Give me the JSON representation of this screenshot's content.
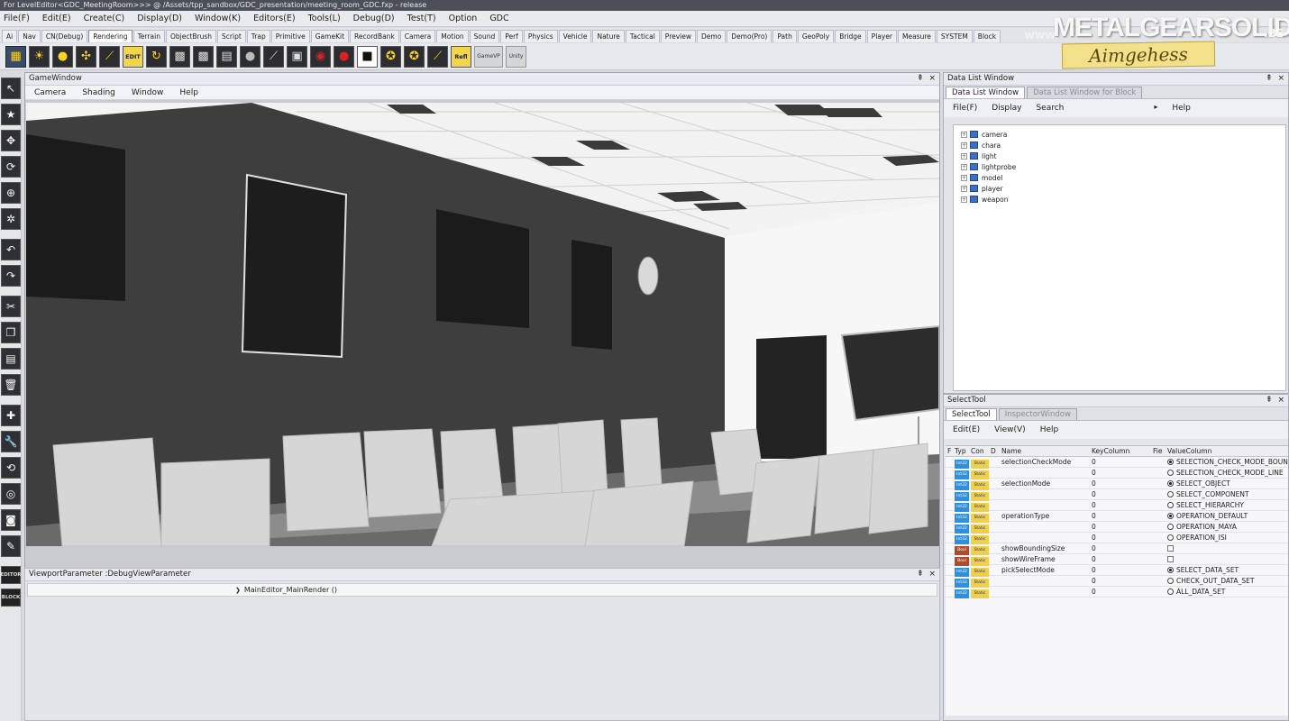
{
  "window": {
    "title": "For LevelEditor<GDC_MeetingRoom>>> @ /Assets/tpp_sandbox/GDC_presentation/meeting_room_GDC.fxp - release"
  },
  "menubar": [
    "File(F)",
    "Edit(E)",
    "Create(C)",
    "Display(D)",
    "Window(K)",
    "Editors(E)",
    "Tools(L)",
    "Debug(D)",
    "Test(T)",
    "Option",
    "GDC"
  ],
  "tabs": [
    "Ai",
    "Nav",
    "CN(Debug)",
    "Rendering",
    "Terrain",
    "ObjectBrush",
    "Script",
    "Trap",
    "Primitive",
    "GameKit",
    "RecordBank",
    "Camera",
    "Motion",
    "Sound",
    "Perf",
    "Physics",
    "Vehicle",
    "Nature",
    "Tactical",
    "Preview",
    "Demo",
    "Demo(Pro)",
    "Path",
    "GeoPoly",
    "Bridge",
    "Player",
    "Measure",
    "SYSTEM",
    "Block"
  ],
  "active_tab": "Rendering",
  "toolbar": {
    "buttons": [
      "image-icon",
      "sun-icon",
      "bulb-icon",
      "fan-icon",
      "feather-icon",
      "edit-icon",
      "cycle-icon",
      "checker-icon",
      "checker2-icon",
      "grid-icon",
      "sphere-icon",
      "brush-icon",
      "frame-icon",
      "record-icon",
      "record-dot-icon",
      "stop-icon",
      "owl-icon",
      "owl2-icon",
      "feather2-icon",
      "refl-icon"
    ],
    "edit_label": "EDIT",
    "refl_label": "Refl",
    "extra1": "GameVP",
    "extra2": "Unity"
  },
  "left_tools": {
    "editor_label": "EDITOR",
    "block_label": "BLOCK"
  },
  "game_window": {
    "title": "GameWindow",
    "menu": [
      "Camera",
      "Shading",
      "Window",
      "Help"
    ],
    "close": "×"
  },
  "viewport_param": {
    "title": "ViewportParameter :DebugViewParameter",
    "row": "MainEditor_MainRender ()",
    "close": "×"
  },
  "data_list": {
    "title": "Data List Window",
    "tabs": [
      "Data List Window",
      "Data List Window for Block"
    ],
    "menu": [
      "File(F)",
      "Display",
      "Search",
      "Help"
    ],
    "search_arrow": "▸",
    "items": [
      "camera",
      "chara",
      "light",
      "lightprobe",
      "model",
      "player",
      "weapon"
    ],
    "close": "×"
  },
  "select_tool": {
    "title": "SelectTool",
    "tabs": [
      "SelectTool",
      "InspectorWindow"
    ],
    "menu": [
      "Edit(E)",
      "View(V)",
      "Help"
    ],
    "headers": {
      "f": "F",
      "typ": "Typ",
      "con": "Con",
      "d": "D",
      "name": "Name",
      "key": "KeyColumn",
      "fi": "Fie",
      "val": "ValueColumn"
    },
    "rows": [
      {
        "type": "Int32",
        "con": "Static",
        "name": "selectionCheckMode",
        "key": "0",
        "val": "SELECTION_CHECK_MODE_BOUN",
        "radio": "on"
      },
      {
        "type": "Int32",
        "con": "Static",
        "name": "",
        "key": "0",
        "val": "SELECTION_CHECK_MODE_LINE",
        "radio": "off"
      },
      {
        "type": "Int32",
        "con": "Static",
        "name": "selectionMode",
        "key": "0",
        "val": "SELECT_OBJECT",
        "radio": "on"
      },
      {
        "type": "Int32",
        "con": "Static",
        "name": "",
        "key": "0",
        "val": "SELECT_COMPONENT",
        "radio": "off"
      },
      {
        "type": "Int32",
        "con": "Static",
        "name": "",
        "key": "0",
        "val": "SELECT_HIERARCHY",
        "radio": "off"
      },
      {
        "type": "Int32",
        "con": "Static",
        "name": "operationType",
        "key": "0",
        "val": "OPERATION_DEFAULT",
        "radio": "on"
      },
      {
        "type": "Int32",
        "con": "Static",
        "name": "",
        "key": "0",
        "val": "OPERATION_MAYA",
        "radio": "off"
      },
      {
        "type": "Int32",
        "con": "Static",
        "name": "",
        "key": "0",
        "val": "OPERATION_ISI",
        "radio": "off"
      },
      {
        "type": "Bool",
        "con": "Static",
        "name": "showBoundingSize",
        "key": "0",
        "val": "",
        "radio": "chk"
      },
      {
        "type": "Bool",
        "con": "Static",
        "name": "showWireFrame",
        "key": "0",
        "val": "",
        "radio": "chk"
      },
      {
        "type": "Int32",
        "con": "Static",
        "name": "pickSelectMode",
        "key": "0",
        "val": "SELECT_DATA_SET",
        "radio": "on"
      },
      {
        "type": "Int32",
        "con": "Static",
        "name": "",
        "key": "0",
        "val": "CHECK_OUT_DATA_SET",
        "radio": "off"
      },
      {
        "type": "Int32",
        "con": "Static",
        "name": "",
        "key": "0",
        "val": "ALL_DATA_SET",
        "radio": "off"
      }
    ],
    "close": "×"
  },
  "watermark": {
    "prefix": "www.",
    "site": "METALGEARSOLID",
    "suffix": ".BE",
    "tag": "Aimgehess"
  },
  "colors": {
    "accent": "#3d6fc4",
    "int_badge": "#2d8fe0",
    "bool_badge": "#b04a2a",
    "static_badge": "#f0d04a"
  }
}
